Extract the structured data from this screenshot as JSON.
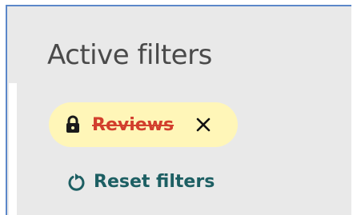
{
  "panel": {
    "title": "Active filters"
  },
  "chip": {
    "label": "Reviews",
    "lock_icon": "lock-icon",
    "close_icon": "close-icon",
    "colors": {
      "background": "#fff6b8",
      "label": "#d23f2d",
      "icon": "#121212"
    }
  },
  "reset": {
    "label": "Reset filters",
    "icon": "reset-icon",
    "color": "#1d5f63"
  },
  "colors": {
    "panel_background": "#e9e9e9",
    "panel_border": "#5b87c9",
    "title": "#4a4a4a"
  }
}
